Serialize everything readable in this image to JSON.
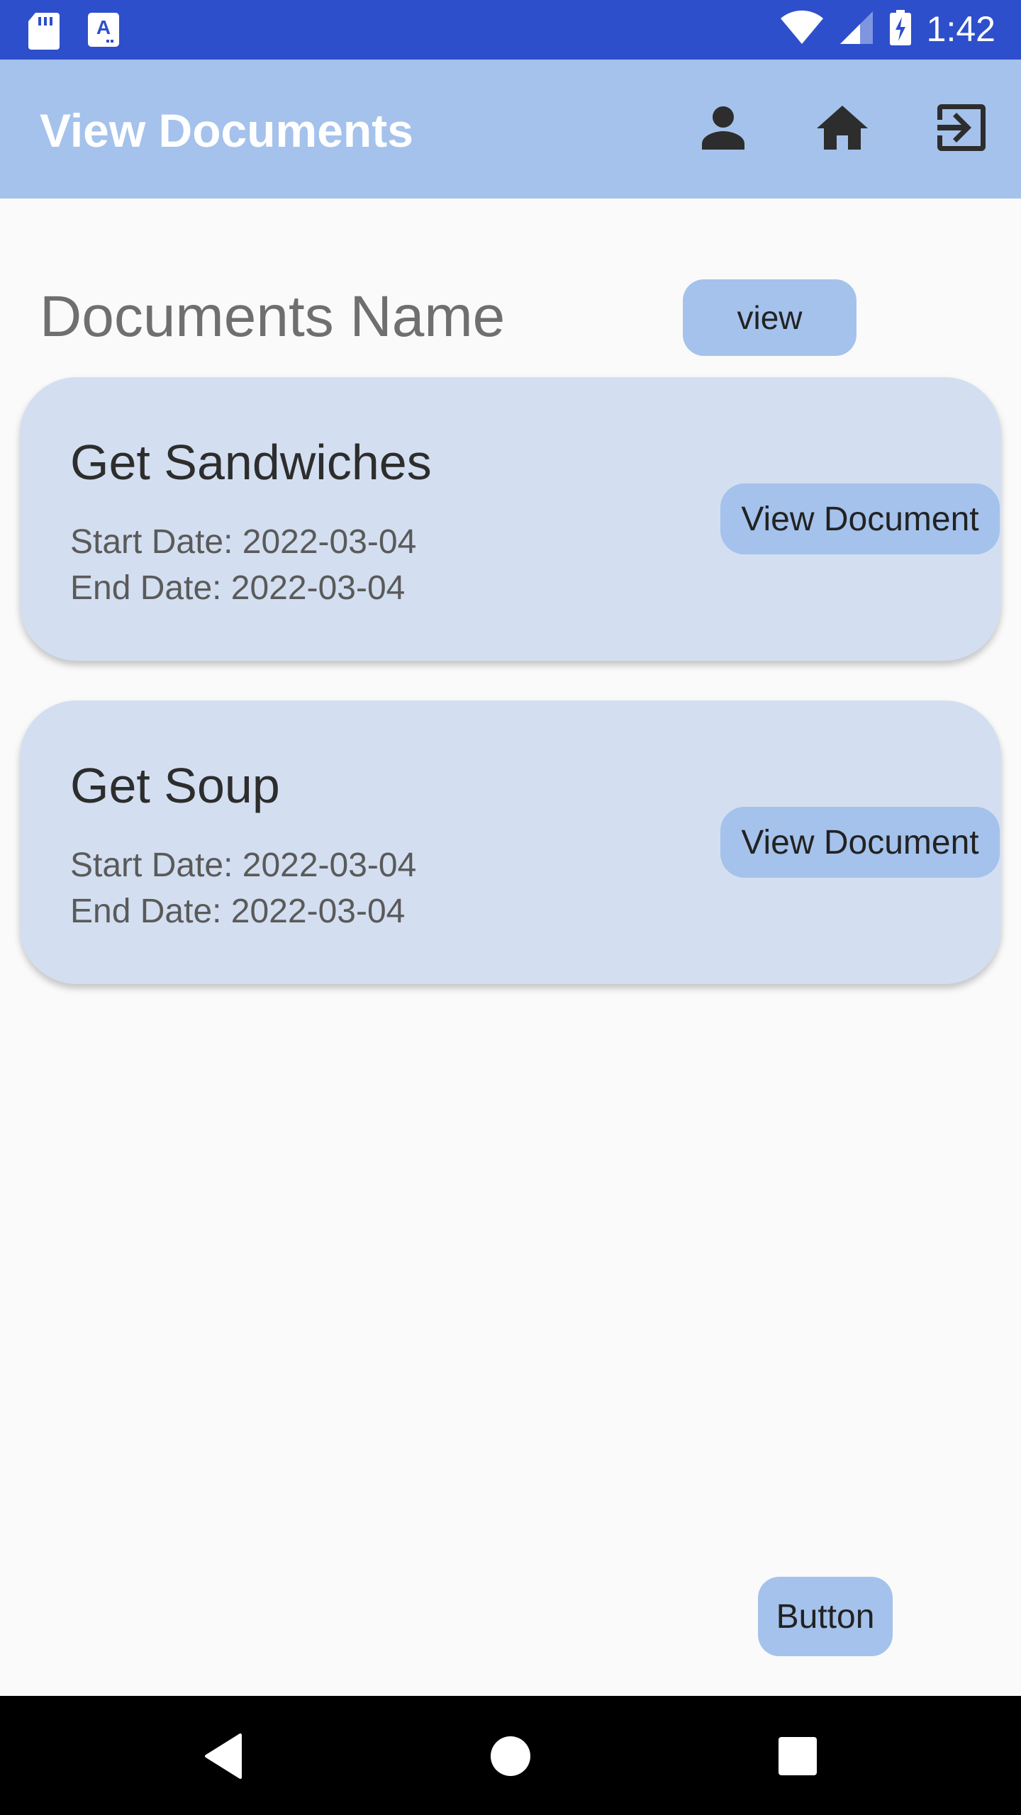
{
  "status_bar": {
    "time": "1:42",
    "icons": [
      "sd-card-icon",
      "keyboard-a-icon",
      "wifi-icon",
      "signal-icon",
      "battery-charging-icon"
    ]
  },
  "app_bar": {
    "title": "View Documents",
    "actions": [
      "person-icon",
      "home-icon",
      "logout-icon"
    ]
  },
  "list_header": {
    "label": "Documents Name",
    "view_button": "view"
  },
  "documents": [
    {
      "title": "Get Sandwiches",
      "start": "Start Date: 2022-03-04",
      "end": "End Date: 2022-03-04",
      "button": "View Document"
    },
    {
      "title": "Get Soup",
      "start": "Start Date: 2022-03-04",
      "end": "End Date: 2022-03-04",
      "button": "View Document"
    }
  ],
  "footer": {
    "button": "Button"
  },
  "nav_bar": [
    "back-icon",
    "home-circle-icon",
    "recents-icon"
  ],
  "colors": {
    "status_bar": "#2e4fcb",
    "app_bar": "#a4c2eb",
    "card": "#d3dff0",
    "button": "#a4c2eb",
    "background": "#fafafa"
  }
}
